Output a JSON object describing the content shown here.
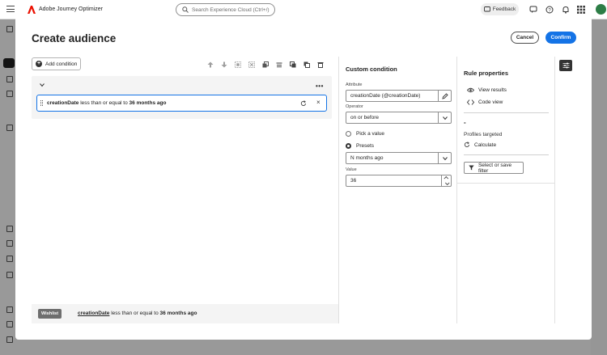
{
  "app": {
    "title": "Adobe Journey Optimizer",
    "search_placeholder": "Search Experience Cloud (Ctrl+/)",
    "feedback_label": "Feedback"
  },
  "modal": {
    "title": "Create audience",
    "cancel_label": "Cancel",
    "confirm_label": "Confirm"
  },
  "canvas": {
    "add_condition_label": "Add condition",
    "toolbar": [
      "move-up",
      "move-down",
      "group",
      "ungroup",
      "copy",
      "archive",
      "duplicate",
      "paste",
      "delete"
    ],
    "condition": {
      "attribute": "creationDate",
      "operator_text": "less than or equal to",
      "value_text": "36 months ago"
    },
    "summary": {
      "tag": "Wishlist",
      "attribute": "creationDate",
      "operator_text": "less than or equal to",
      "value_text": "36 months ago"
    }
  },
  "custom_condition": {
    "title": "Custom condition",
    "attribute_label": "Attribute",
    "attribute_value": "creationDate (@creationDate)",
    "operator_label": "Operator",
    "operator_value": "on or before",
    "option_pick": "Pick a value",
    "option_presets": "Presets",
    "preset_value": "N months ago",
    "value_label": "Value",
    "value": "36"
  },
  "rule_properties": {
    "title": "Rule properties",
    "view_results": "View results",
    "code_view": "Code view",
    "profiles_count": "-",
    "profiles_label": "Profiles targeted",
    "calculate_label": "Calculate",
    "filter_label": "Select or save filter"
  },
  "colors": {
    "accent": "#1473e6",
    "overlay": "#000000",
    "panel_bg": "#f4f4f4"
  }
}
